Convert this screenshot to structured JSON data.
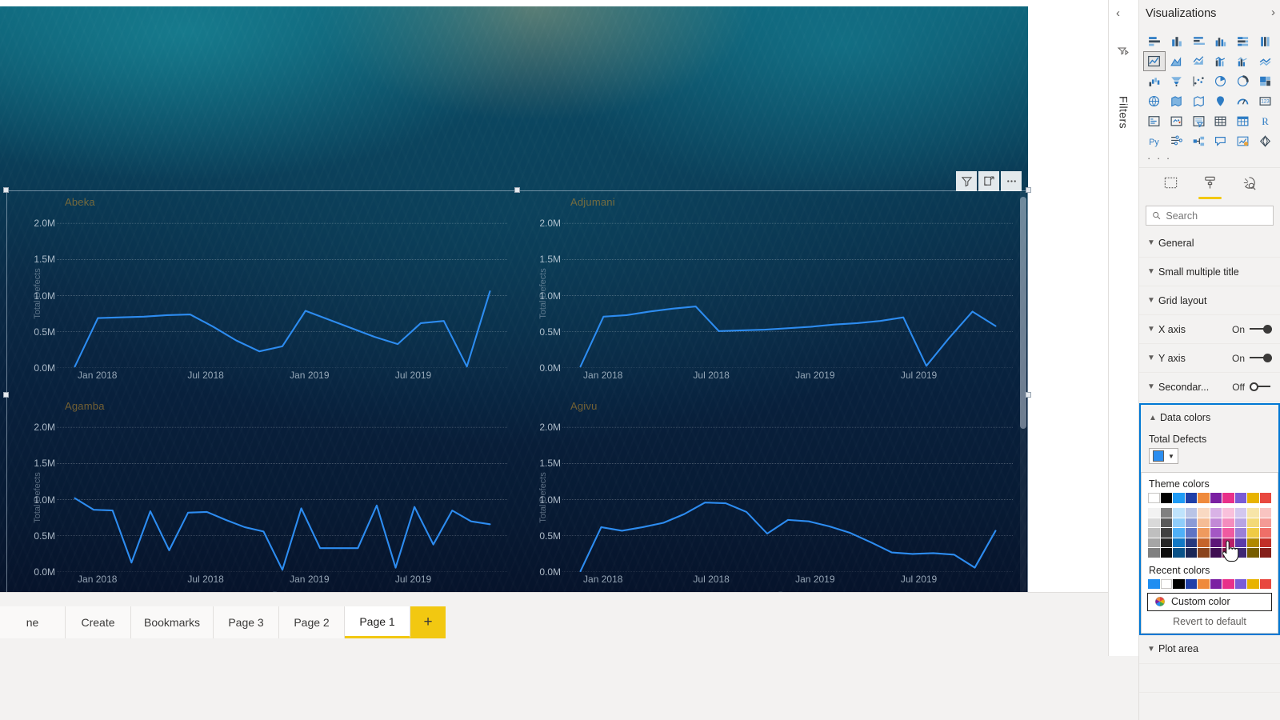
{
  "report": {
    "visual_header": {
      "filter_icon": "filter-icon",
      "focus_icon": "focus-mode-icon",
      "more_icon": "more-options-icon",
      "more_label": "..."
    },
    "page_tabs": [
      {
        "label": "ne",
        "active": false
      },
      {
        "label": "Create",
        "active": false
      },
      {
        "label": "Bookmarks",
        "active": false
      },
      {
        "label": "Page 3",
        "active": false
      },
      {
        "label": "Page 2",
        "active": false
      },
      {
        "label": "Page 1",
        "active": true
      }
    ],
    "add_page_label": "+"
  },
  "filters_pane": {
    "collapse_label": "‹",
    "title": "Filters",
    "icon": "filter-arrow-icon"
  },
  "visualizations_pane": {
    "title": "Visualizations",
    "expand_label": "›",
    "collapse_label": "‹",
    "more_visuals_label": "· · ·",
    "icons": [
      "stacked-bar-chart-icon",
      "stacked-column-chart-icon",
      "clustered-bar-chart-icon",
      "clustered-column-chart-icon",
      "100-stacked-bar-chart-icon",
      "100-stacked-column-chart-icon",
      "line-chart-icon",
      "area-chart-icon",
      "stacked-area-chart-icon",
      "line-and-stacked-column-chart-icon",
      "line-and-clustered-column-chart-icon",
      "ribbon-chart-icon",
      "waterfall-chart-icon",
      "funnel-chart-icon",
      "scatter-chart-icon",
      "pie-chart-icon",
      "donut-chart-icon",
      "treemap-icon",
      "map-icon",
      "filled-map-icon",
      "shape-map-icon",
      "azure-map-icon",
      "gauge-icon",
      "card-icon",
      "multi-row-card-icon",
      "kpi-icon",
      "slicer-icon",
      "table-icon",
      "matrix-icon",
      "r-script-visual-icon",
      "python-visual-icon",
      "key-influencers-icon",
      "decomposition-tree-icon",
      "qa-visual-icon",
      "smart-narrative-icon",
      "paginated-report-icon"
    ],
    "selected_icon_index": 6,
    "format_tabs": [
      {
        "name": "fields-tab",
        "active": false
      },
      {
        "name": "format-tab",
        "active": true
      },
      {
        "name": "analytics-tab",
        "active": false
      }
    ],
    "search": {
      "placeholder": "Search",
      "value": "",
      "icon": "search-icon"
    },
    "format_sections": [
      {
        "label": "General",
        "state": "",
        "toggle": null
      },
      {
        "label": "Small multiple title",
        "state": "",
        "toggle": null
      },
      {
        "label": "Grid layout",
        "state": "",
        "toggle": null
      },
      {
        "label": "X axis",
        "state": "On",
        "toggle": "on"
      },
      {
        "label": "Y axis",
        "state": "On",
        "toggle": "on"
      },
      {
        "label": "Secondar...",
        "state": "Off",
        "toggle": "off"
      }
    ],
    "data_colors": {
      "header": "Data colors",
      "series_label": "Total Defects",
      "series_color": "#2c8ef0",
      "dropdown_open": true,
      "theme_colors_label": "Theme colors",
      "recent_colors_label": "Recent colors",
      "custom_color_label": "Custom color",
      "custom_color_icon": "color-wheel-icon",
      "revert_label": "Revert to default",
      "theme_base": [
        "#ffffff",
        "#000000",
        "#1f9bf5",
        "#1f3fa8",
        "#ef8a3c",
        "#7b1fa2",
        "#e8308a",
        "#7a5bd6",
        "#e8b300",
        "#e8483f"
      ],
      "theme_shades": [
        [
          "#f2f2f2",
          "#d9d9d9",
          "#bfbfbf",
          "#a6a6a6",
          "#808080"
        ],
        [
          "#808080",
          "#595959",
          "#404040",
          "#262626",
          "#0d0d0d"
        ],
        [
          "#bfe3fc",
          "#8fcdfa",
          "#4fb0f7",
          "#1178c4",
          "#0a5288"
        ],
        [
          "#b9c4e6",
          "#8b9bd6",
          "#5e74c4",
          "#27397d",
          "#1a2655"
        ],
        [
          "#f9d9c2",
          "#f5bc95",
          "#ef9a5e",
          "#c5642a",
          "#8a441d"
        ],
        [
          "#d9b2e6",
          "#c289d6",
          "#a457c4",
          "#5c1578",
          "#3f0e52"
        ],
        [
          "#f9c0db",
          "#f48cbd",
          "#ef5aa0",
          "#b81e68",
          "#7d1447"
        ],
        [
          "#d3c7ef",
          "#b8a4e4",
          "#9b7fd6",
          "#5b3aa8",
          "#3e2774"
        ],
        [
          "#f7e5a8",
          "#f3d977",
          "#efcb45",
          "#b08900",
          "#775d00"
        ],
        [
          "#f9c4c1",
          "#f49a95",
          "#ef6f68",
          "#c12f27",
          "#85201a"
        ]
      ],
      "recent_colors": [
        "#1f8ef1",
        "#ffffff",
        "#000000",
        "#1f3fa8",
        "#ef8a3c",
        "#7b1fa2",
        "#e8308a",
        "#7a5bd6",
        "#e8b300",
        "#e8483f"
      ]
    },
    "plot_area_label": "Plot area"
  },
  "chart_data": {
    "type": "line",
    "title": "",
    "xlabel": "Date",
    "ylabel": "Total Defects",
    "ylim": [
      0,
      2200000
    ],
    "yticks": [
      "0.0M",
      "0.5M",
      "1.0M",
      "1.5M",
      "2.0M"
    ],
    "ytick_values": [
      0,
      500000,
      1000000,
      1500000,
      2000000
    ],
    "xticks": [
      "Jan 2018",
      "Jul 2018",
      "Jan 2019",
      "Jul 2019"
    ],
    "xtick_positions": [
      0.09,
      0.33,
      0.56,
      0.79
    ],
    "grid": true,
    "legend": "none",
    "series_name": "Total Defects",
    "series_color": "#2d8cf0",
    "small_multiples": [
      {
        "name": "Abeka",
        "values": [
          0.02,
          0.69,
          0.7,
          0.71,
          0.73,
          0.74,
          0.57,
          0.38,
          0.23,
          0.3,
          0.79,
          0.67,
          0.55,
          0.43,
          0.33,
          0.62,
          0.65,
          0.02,
          1.06
        ]
      },
      {
        "name": "Adjumani",
        "values": [
          0.02,
          0.71,
          0.73,
          0.78,
          0.82,
          0.85,
          0.51,
          0.52,
          0.53,
          0.55,
          0.57,
          0.6,
          0.62,
          0.65,
          0.7,
          0.03,
          0.42,
          0.78,
          0.58
        ]
      },
      {
        "name": "Agamba",
        "values": [
          1.02,
          0.86,
          0.85,
          0.13,
          0.84,
          0.3,
          0.82,
          0.83,
          0.72,
          0.62,
          0.56,
          0.03,
          0.88,
          0.33,
          0.33,
          0.33,
          0.92,
          0.06,
          0.9,
          0.38,
          0.85,
          0.7,
          0.66
        ]
      },
      {
        "name": "Agivu",
        "values": [
          0.01,
          0.62,
          0.57,
          0.62,
          0.68,
          0.8,
          0.96,
          0.95,
          0.83,
          0.53,
          0.72,
          0.7,
          0.63,
          0.54,
          0.41,
          0.27,
          0.25,
          0.26,
          0.24,
          0.06,
          0.57
        ]
      }
    ]
  }
}
